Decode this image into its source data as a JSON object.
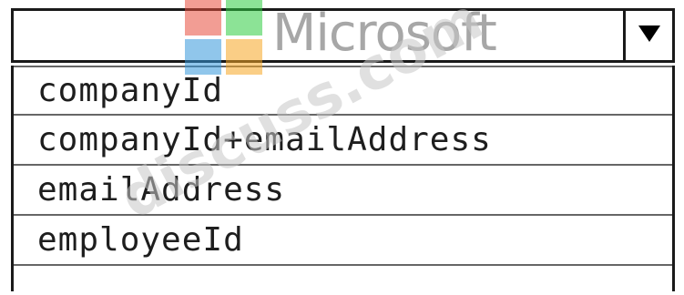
{
  "dropdown": {
    "selected_value": "",
    "arrow_icon": "triangle-down-icon"
  },
  "options": [
    "companyId",
    "companyId+emailAddress",
    "emailAddress",
    "employeeId"
  ],
  "watermark": {
    "brand": "Microsoft",
    "url": "discuss.com",
    "colors": {
      "red": "#e74c3c",
      "green": "#2ecc40",
      "blue": "#3498db",
      "yellow": "#f5a623"
    }
  }
}
